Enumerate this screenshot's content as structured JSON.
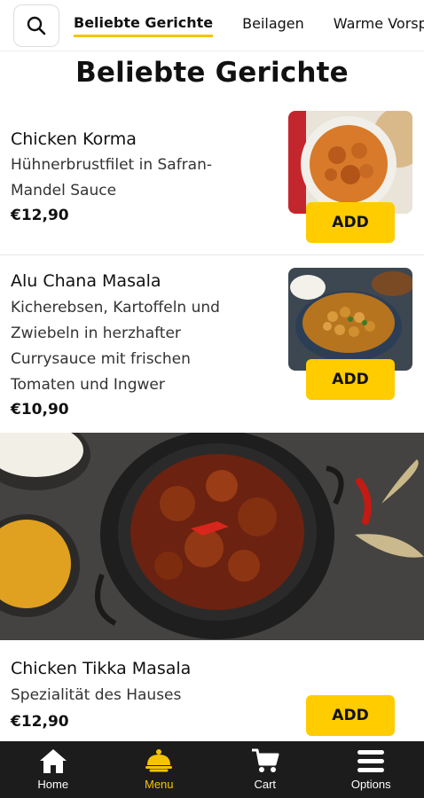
{
  "header": {
    "tabs": [
      {
        "label": "Beliebte Gerichte",
        "active": true
      },
      {
        "label": "Beilagen",
        "active": false
      },
      {
        "label": "Warme Vorsp",
        "active": false
      }
    ]
  },
  "section": {
    "title": "Beliebte Gerichte"
  },
  "items": [
    {
      "name": "Chicken Korma",
      "desc": [
        "Hühnerbrustfilet in Safran-",
        "Mandel Sauce"
      ],
      "price": "€12,90",
      "add_label": "ADD"
    },
    {
      "name": "Alu Chana Masala",
      "desc": [
        "Kicherebsen, Kartoffeln und",
        "Zwiebeln in herzhafter",
        "Currysauce mit frischen",
        "Tomaten und Ingwer"
      ],
      "price": "€10,90",
      "add_label": "ADD"
    },
    {
      "name": "Chicken Tikka Masala",
      "desc": [
        "Spezialität des Hauses"
      ],
      "price": "€12,90",
      "add_label": "ADD"
    }
  ],
  "bottom_nav": [
    {
      "label": "Home",
      "icon": "home-icon",
      "active": false
    },
    {
      "label": "Menu",
      "icon": "menu-cloche-icon",
      "active": true
    },
    {
      "label": "Cart",
      "icon": "cart-icon",
      "active": false
    },
    {
      "label": "Options",
      "icon": "hamburger-icon",
      "active": false
    }
  ],
  "colors": {
    "accent": "#ffcc00",
    "nav_bg": "#1c1c1c",
    "nav_active": "#f5c400"
  }
}
